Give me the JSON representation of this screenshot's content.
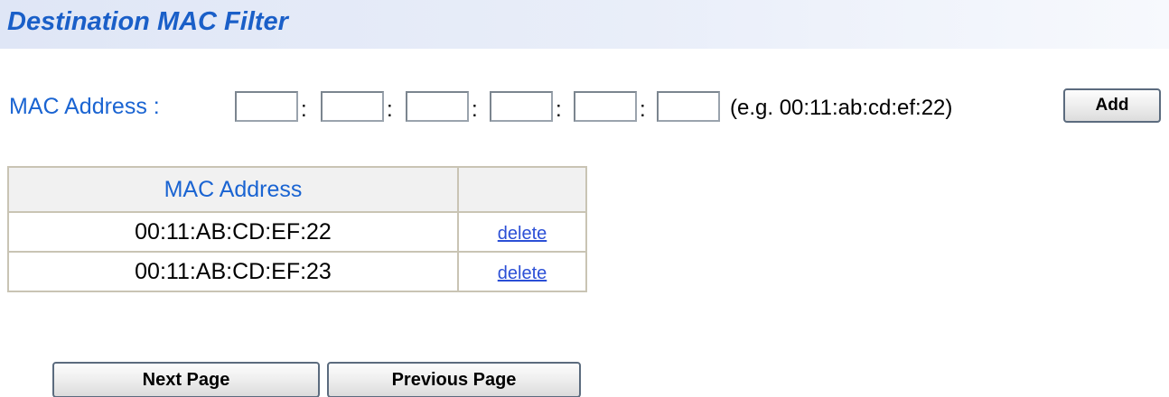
{
  "header": {
    "title": "Destination MAC Filter"
  },
  "mac_input": {
    "label": "MAC Address :",
    "octets": [
      "",
      "",
      "",
      "",
      "",
      ""
    ],
    "separator": ":",
    "example": "(e.g. 00:11:ab:cd:ef:22)",
    "add_label": "Add"
  },
  "table": {
    "headers": [
      "MAC Address",
      ""
    ],
    "rows": [
      {
        "mac": "00:11:AB:CD:EF:22",
        "action": "delete"
      },
      {
        "mac": "00:11:AB:CD:EF:23",
        "action": "delete"
      }
    ]
  },
  "pagination": {
    "next_label": "Next Page",
    "prev_label": "Previous Page"
  },
  "colors": {
    "heading_blue": "#1a5fc8",
    "label_blue": "#1a64d2",
    "link_blue": "#2b4fd6",
    "table_border": "#c9c4b4"
  }
}
